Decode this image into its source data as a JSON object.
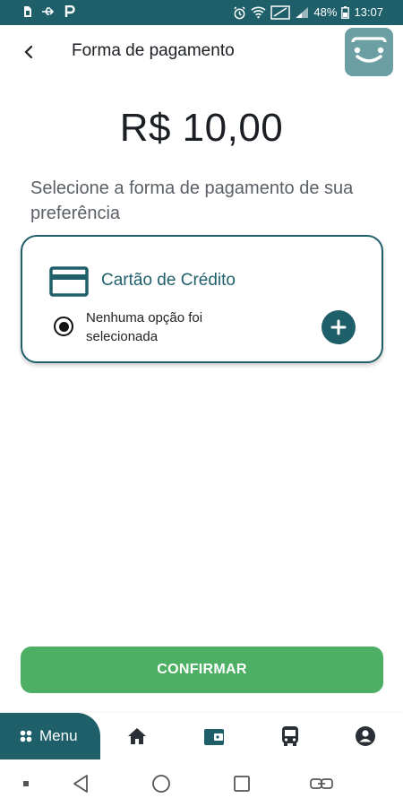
{
  "status_bar": {
    "battery_percent": "48%",
    "time": "13:07",
    "icons": [
      "sim-icon",
      "usb-icon",
      "parking-icon",
      "alarm-icon",
      "wifi-icon",
      "no-signal-icon",
      "signal-icon",
      "battery-icon"
    ]
  },
  "header": {
    "title": "Forma de pagamento",
    "back_icon": "chevron-left-icon",
    "logo_icon": "smile-bag-logo"
  },
  "payment": {
    "amount": "R$ 10,00",
    "instructions": "Selecione a forma de pagamento de sua preferência",
    "method": {
      "title": "Cartão de Crédito",
      "icon": "credit-card-icon",
      "selection_text": "Nenhuma opção foi selecionada",
      "add_icon": "plus-icon"
    }
  },
  "actions": {
    "confirm_label": "CONFIRMAR"
  },
  "bottom_nav": {
    "menu_label": "Menu",
    "items": [
      "home-icon",
      "wallet-icon",
      "bus-icon",
      "account-icon"
    ]
  },
  "system_nav": {
    "items": [
      "dot-icon",
      "back-triangle-icon",
      "home-circle-icon",
      "recents-square-icon",
      "link-icon"
    ]
  },
  "colors": {
    "primary": "#1f5f69",
    "confirm": "#4caf63",
    "logo_bg": "#6c9fa3",
    "text_dark": "#1b1f24",
    "text_muted": "#5b6066"
  }
}
